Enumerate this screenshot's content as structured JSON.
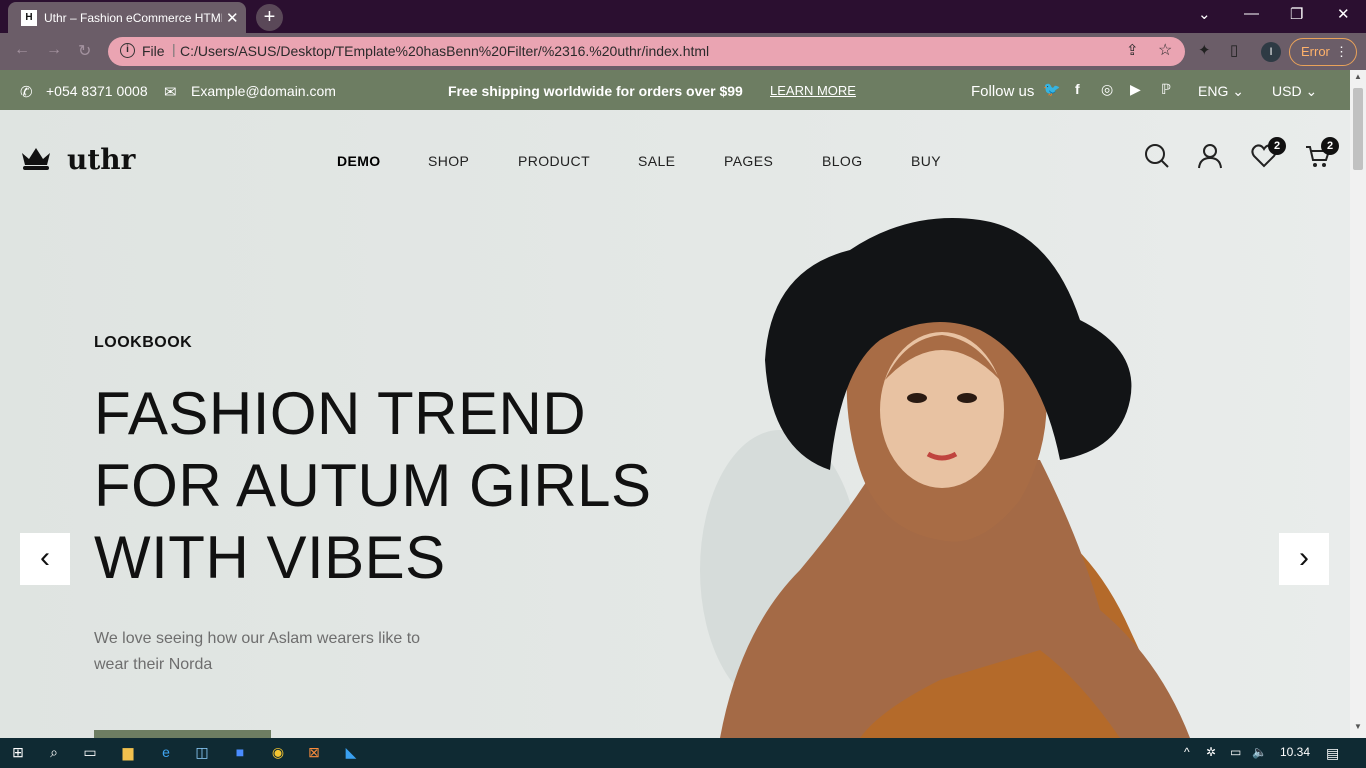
{
  "browser": {
    "tab_title": "Uthr – Fashion eCommerce HTML",
    "favicon_text": "H",
    "file_label": "File",
    "url": "C:/Users/ASUS/Desktop/TEmplate%20hasBenn%20Filter/%2316.%20uthr/index.html",
    "error_label": "Error",
    "profile_initial": "I"
  },
  "topbar": {
    "phone": "+054 8371 0008",
    "email": "Example@domain.com",
    "shipping": "Free shipping worldwide for orders over $99",
    "learn_more": "LEARN MORE",
    "follow": "Follow us",
    "language": "ENG",
    "currency": "USD"
  },
  "header": {
    "logo": "uthr",
    "nav": [
      "DEMO",
      "SHOP",
      "PRODUCT",
      "SALE",
      "PAGES",
      "BLOG",
      "BUY"
    ],
    "wishlist_count": "2",
    "cart_count": "2"
  },
  "hero": {
    "eyebrow": "LOOKBOOK",
    "headline_1": "FASHION TREND",
    "headline_2": "FOR AUTUM GIRLS",
    "headline_3": "WITH VIBES",
    "subtitle": "We love seeing how our Aslam wearers like to wear their Norda"
  },
  "taskbar": {
    "time": "10.34"
  },
  "colors": {
    "topbar_bg": "#6d7d62",
    "tab_strip": "#2b0f30",
    "omnibox": "#eaa4b2"
  }
}
